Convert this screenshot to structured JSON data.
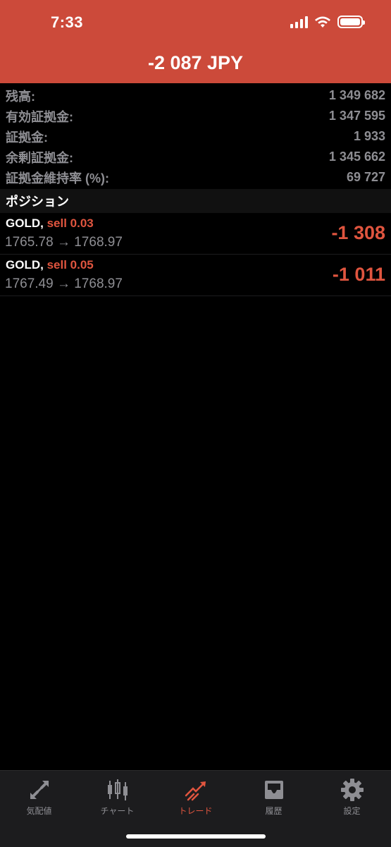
{
  "status_bar": {
    "time": "7:33"
  },
  "header": {
    "total_pl": "-2 087 JPY",
    "background_color": "#cc4a3a"
  },
  "summary": [
    {
      "label": "残高:",
      "value": "1 349 682"
    },
    {
      "label": "有効証拠金:",
      "value": "1 347 595"
    },
    {
      "label": "証拠金:",
      "value": "1 933"
    },
    {
      "label": "余剰証拠金:",
      "value": "1 345 662"
    },
    {
      "label": "証拠金維持率 (%):",
      "value": "69 727"
    }
  ],
  "positions_section": {
    "title": "ポジション"
  },
  "positions": [
    {
      "symbol": "GOLD,",
      "side": "sell 0.03",
      "prices": "1765.78 → 1768.97",
      "pl": "-1 308"
    },
    {
      "symbol": "GOLD,",
      "side": "sell 0.05",
      "prices": "1767.49 → 1768.97",
      "pl": "-1 011"
    }
  ],
  "tabbar": {
    "tabs": [
      {
        "label": "気配値",
        "icon": "quotes-arrows-icon",
        "active": false
      },
      {
        "label": "チャート",
        "icon": "candlestick-chart-icon",
        "active": false
      },
      {
        "label": "トレード",
        "icon": "trade-trend-icon",
        "active": true
      },
      {
        "label": "履歴",
        "icon": "history-inbox-icon",
        "active": false
      },
      {
        "label": "設定",
        "icon": "gear-icon",
        "active": false
      }
    ]
  },
  "colors": {
    "accent": "#e0553f",
    "inactive": "#8e8e93",
    "background": "#000000"
  }
}
